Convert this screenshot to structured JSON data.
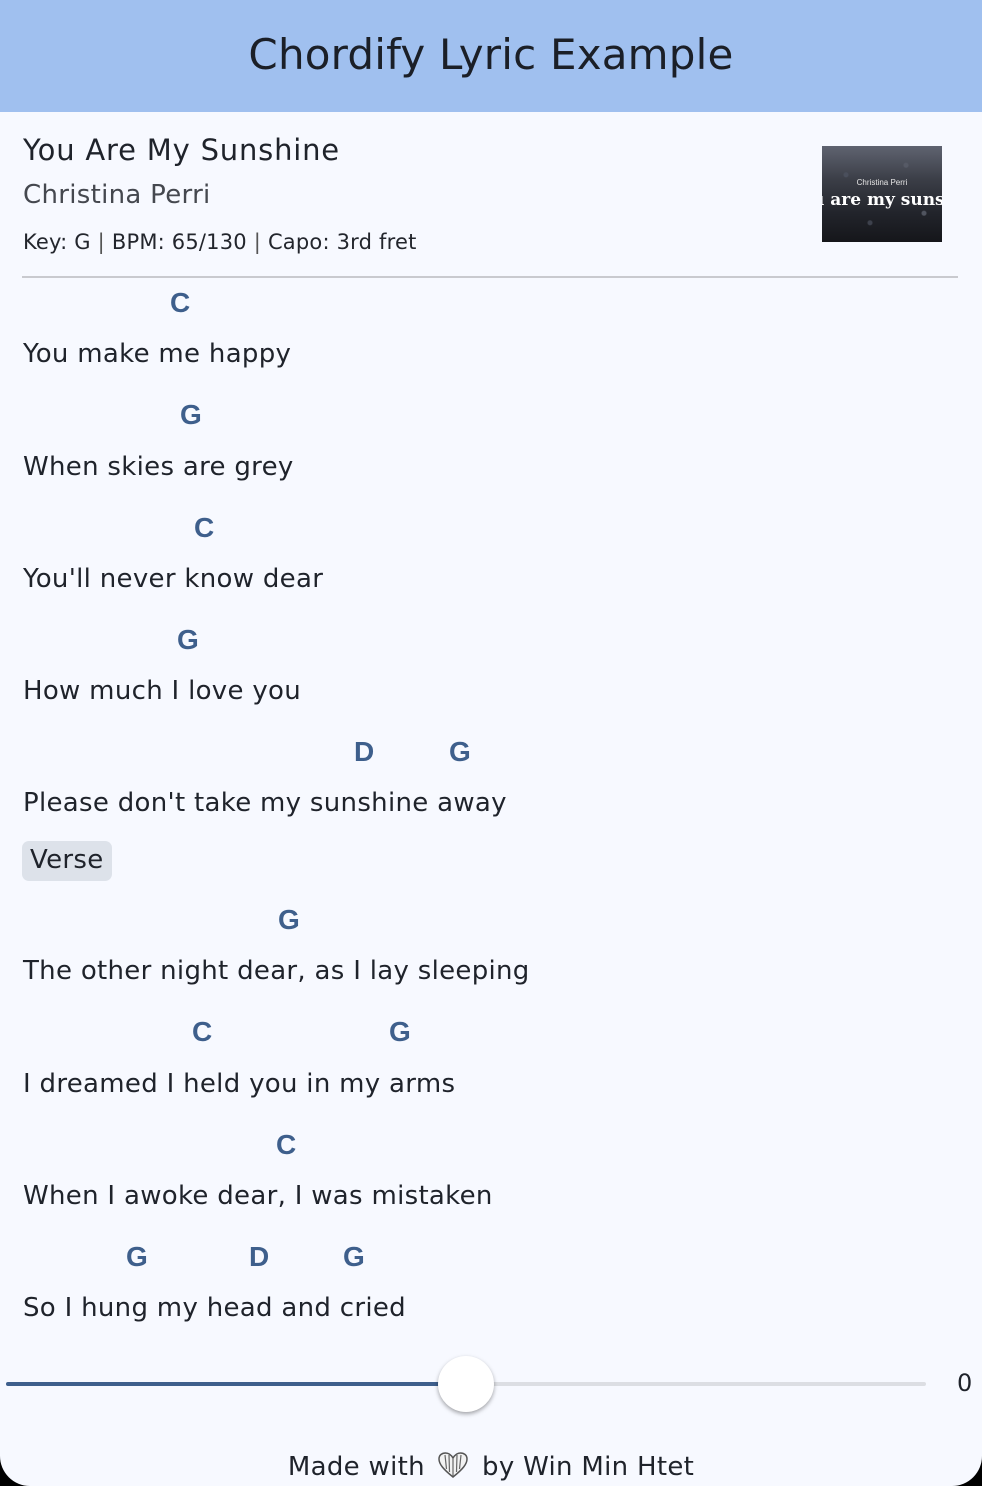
{
  "appbar": {
    "title": "Chordify Lyric Example"
  },
  "song": {
    "title": "You Are My Sunshine",
    "artist": "Christina Perri",
    "key_label": "Key: G",
    "bpm_label": "BPM: 65/130",
    "capo_label": "Capo: 3rd fret",
    "separator": "|",
    "cover": {
      "artist_text": "Christina Perri",
      "title_text": "u are my sunshi"
    }
  },
  "lyrics": {
    "lines": [
      {
        "text": "You make me happy",
        "chords": [
          "C"
        ]
      },
      {
        "text": "When skies are grey",
        "chords": [
          "G"
        ]
      },
      {
        "text": "You'll never know dear",
        "chords": [
          "C"
        ]
      },
      {
        "text": "How much I love you",
        "chords": [
          "G"
        ]
      },
      {
        "text": "Please don't take my sunshine away",
        "chords": [
          "D",
          "G"
        ]
      },
      {
        "text": "The other night dear, as I lay sleeping",
        "chords": [
          "G"
        ]
      },
      {
        "text": "I dreamed I held you in my arms",
        "chords": [
          "C",
          "G"
        ]
      },
      {
        "text": "When I awoke dear, I was mistaken",
        "chords": [
          "C"
        ]
      },
      {
        "text": "So I hung my head and cried",
        "chords": [
          "G",
          "D",
          "G"
        ]
      }
    ],
    "section_label": "Verse"
  },
  "slider": {
    "value_label": "0",
    "position_fraction": 0.5
  },
  "footer": {
    "prefix": "Made with",
    "suffix": "by Win Min Htet",
    "icon": "heart-icon"
  },
  "colors": {
    "appbar_bg": "#a0c0ef",
    "background": "#f7f9ff",
    "chord": "#3e5f8c",
    "chip_bg": "#dde2ea"
  }
}
